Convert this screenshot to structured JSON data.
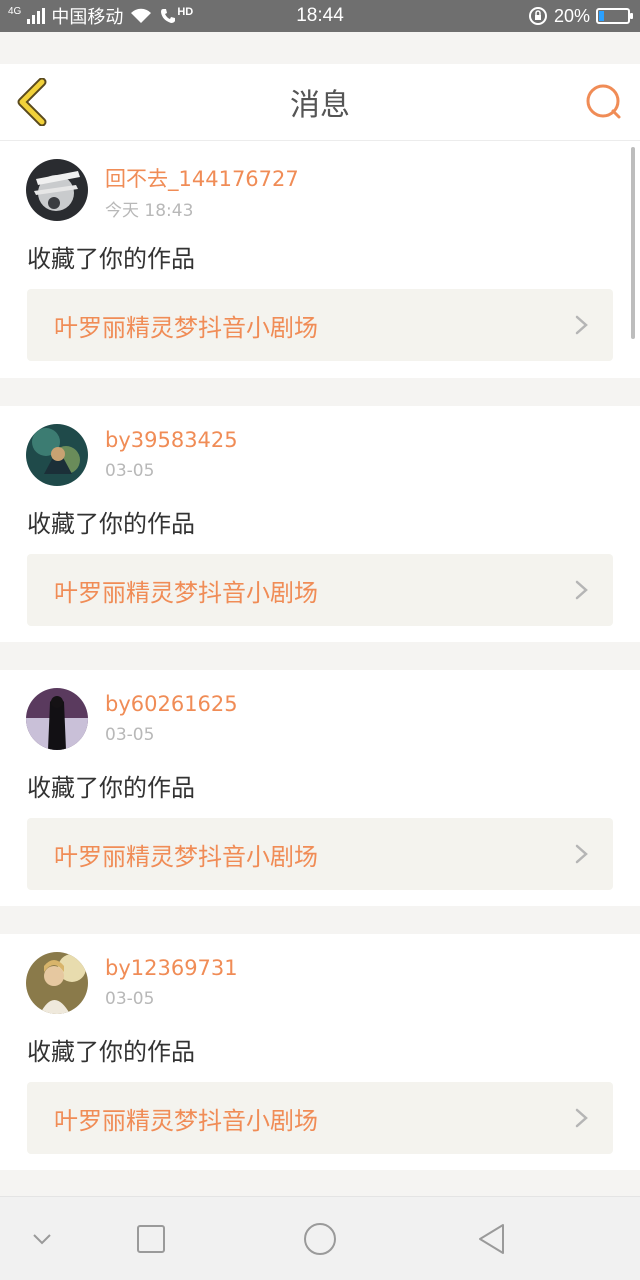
{
  "status_bar": {
    "network": "4G",
    "carrier": "中国移动",
    "hd": "HD",
    "time": "18:44",
    "battery": "20%",
    "battery_level": 0.2
  },
  "header": {
    "title": "消息",
    "accent_color": "#f08c56",
    "back_icon_color": "#f2d23a"
  },
  "messages": [
    {
      "name": "回不去_144176727",
      "time": "今天 18:43",
      "action": "收藏了你的作品",
      "work": "叶罗丽精灵梦抖音小剧场"
    },
    {
      "name": "by39583425",
      "time": "03-05",
      "action": "收藏了你的作品",
      "work": "叶罗丽精灵梦抖音小剧场"
    },
    {
      "name": "by60261625",
      "time": "03-05",
      "action": "收藏了你的作品",
      "work": "叶罗丽精灵梦抖音小剧场"
    },
    {
      "name": "by12369731",
      "time": "03-05",
      "action": "收藏了你的作品",
      "work": "叶罗丽精灵梦抖音小剧场"
    }
  ],
  "nav_bar": {
    "icons": [
      "chevron-down-icon",
      "square-icon",
      "circle-icon",
      "triangle-back-icon"
    ]
  }
}
